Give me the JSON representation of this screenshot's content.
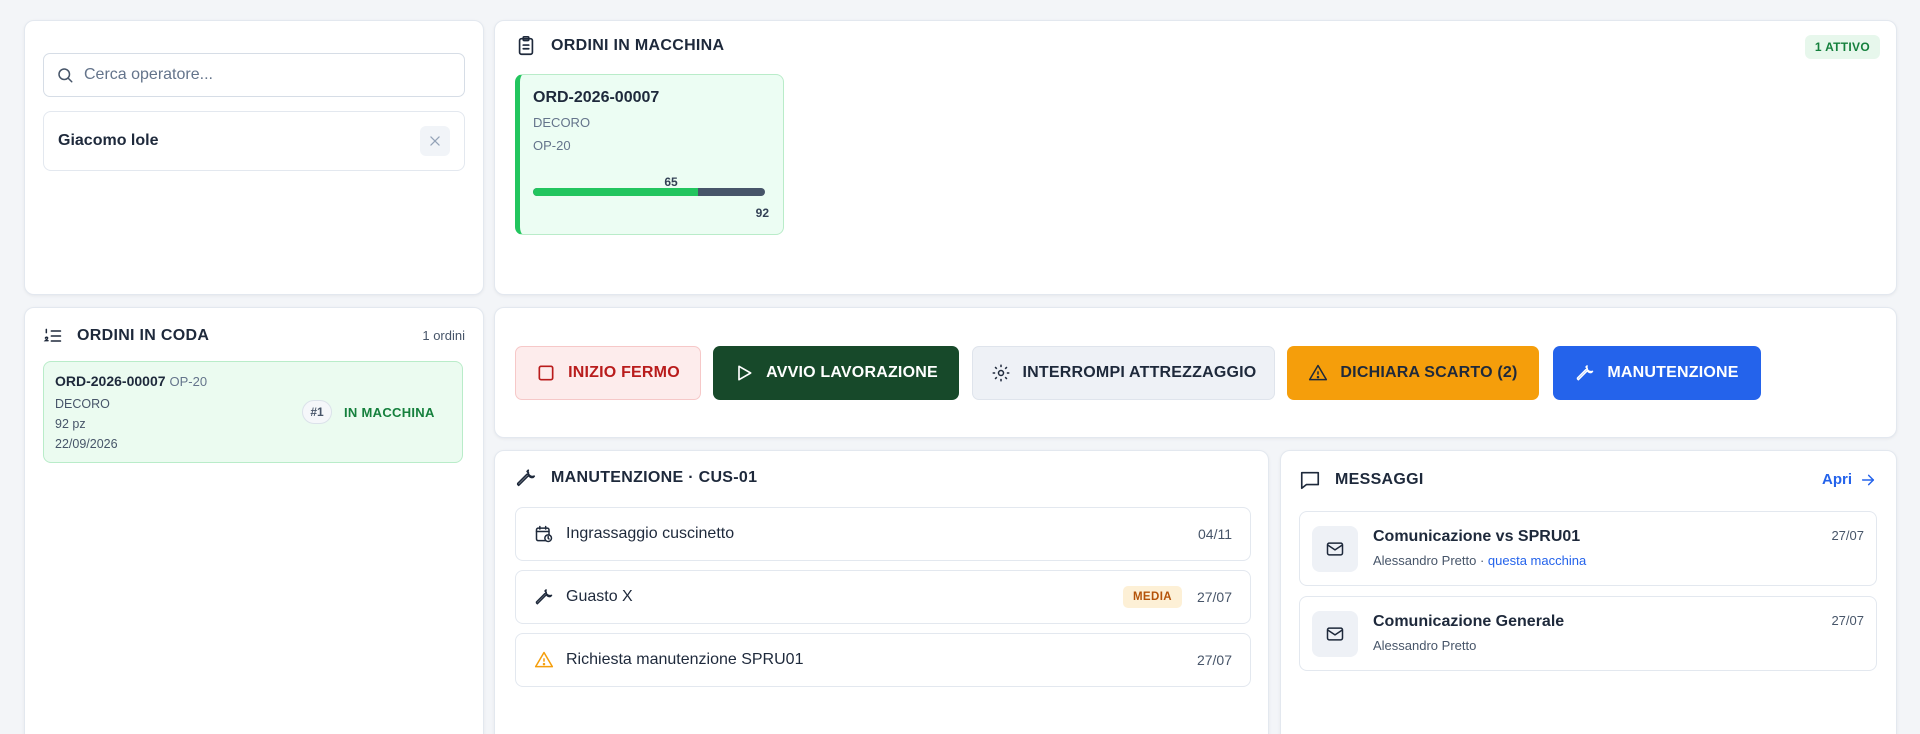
{
  "operator": {
    "search_placeholder": "Cerca operatore...",
    "selected_name": "Giacomo lole"
  },
  "machine_orders": {
    "title": "ORDINI IN MACCHINA",
    "active_badge": "1 ATTIVO",
    "order": {
      "code": "ORD-2026-00007",
      "type": "DECORO",
      "operation": "OP-20",
      "done": "65",
      "total": "92",
      "progress_fraction": 0.71
    }
  },
  "queue": {
    "title": "ORDINI IN CODA",
    "count": "1 ordini",
    "items": [
      {
        "code": "ORD-2026-00007",
        "operation": "OP-20",
        "type": "DECORO",
        "qty": "92 pz",
        "date": "22/09/2026",
        "position": "#1",
        "status": "IN MACCHINA"
      }
    ]
  },
  "actions": {
    "fermo": "INIZIO FERMO",
    "avvio": "AVVIO LAVORAZIONE",
    "attrezzaggio": "INTERROMPI ATTREZZAGGIO",
    "scarto": "DICHIARA SCARTO (2)",
    "manutenzione": "MANUTENZIONE"
  },
  "maintenance": {
    "title": "MANUTENZIONE · CUS-01",
    "items": [
      {
        "icon": "calendar-clock-icon",
        "label": "Ingrassaggio cuscinetto",
        "date": "04/11"
      },
      {
        "icon": "wrench-icon",
        "label": "Guasto X",
        "priority": "MEDIA",
        "date": "27/07"
      },
      {
        "icon": "warning-icon",
        "label": "Richiesta manutenzione SPRU01",
        "date": "27/07"
      }
    ]
  },
  "messages": {
    "title": "MESSAGGI",
    "open_label": "Apri",
    "items": [
      {
        "title": "Comunicazione vs SPRU01",
        "author": "Alessandro Pretto",
        "separator": " · ",
        "target": "questa macchina",
        "date": "27/07"
      },
      {
        "title": "Comunicazione Generale",
        "author": "Alessandro Pretto",
        "date": "27/07"
      }
    ]
  },
  "colors": {
    "accent_green": "#22c55e",
    "dark_green": "#17492a",
    "danger": "#b91c1c",
    "warning": "#f59e0b",
    "primary_blue": "#2463eb"
  }
}
